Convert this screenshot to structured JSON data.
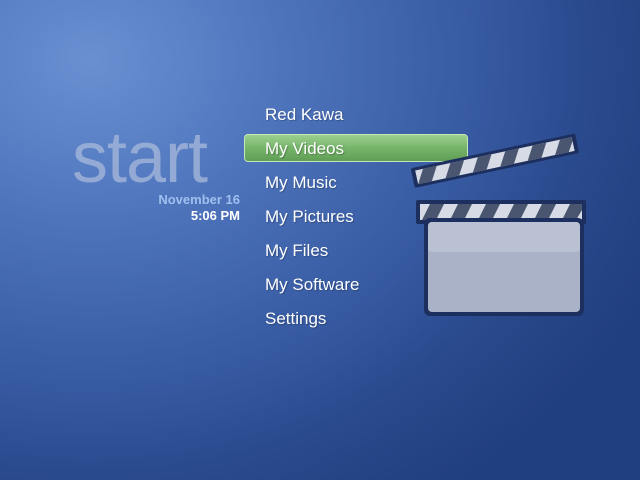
{
  "header": {
    "title": "start",
    "date": "November 16",
    "time": "5:06 PM"
  },
  "menu": {
    "items": [
      {
        "label": "Red Kawa",
        "selected": false
      },
      {
        "label": "My Videos",
        "selected": true
      },
      {
        "label": "My Music",
        "selected": false
      },
      {
        "label": "My Pictures",
        "selected": false
      },
      {
        "label": "My Files",
        "selected": false
      },
      {
        "label": "My Software",
        "selected": false
      },
      {
        "label": "Settings",
        "selected": false
      }
    ]
  },
  "illustration": {
    "icon": "clapperboard-icon"
  },
  "colors": {
    "selection": "#76b46a",
    "background": "#3a5ea6",
    "date_text": "#9fc0ee"
  }
}
